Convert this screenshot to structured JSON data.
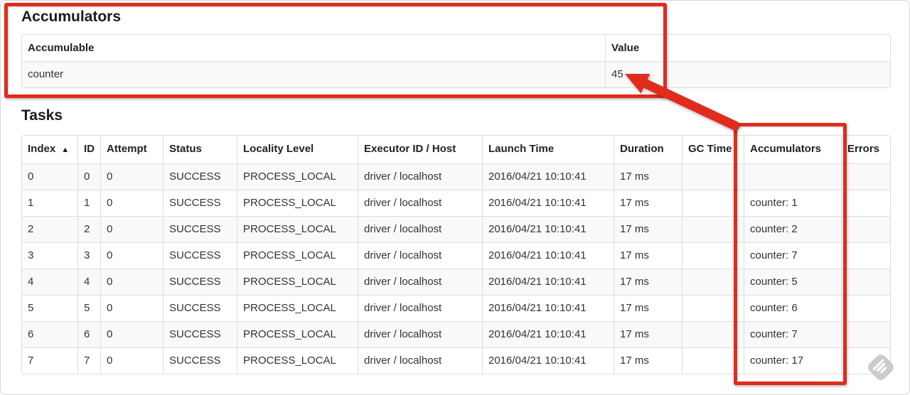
{
  "accumulators_section": {
    "title": "Accumulators",
    "columns": [
      "Accumulable",
      "Value"
    ],
    "rows": [
      {
        "accumulable": "counter",
        "value": "45"
      }
    ]
  },
  "tasks_section": {
    "title": "Tasks",
    "columns": [
      "Index",
      "ID",
      "Attempt",
      "Status",
      "Locality Level",
      "Executor ID / Host",
      "Launch Time",
      "Duration",
      "GC Time",
      "Accumulators",
      "Errors"
    ],
    "sorted_column": "Index",
    "rows": [
      {
        "index": "0",
        "id": "0",
        "attempt": "0",
        "status": "SUCCESS",
        "locality": "PROCESS_LOCAL",
        "executor": "driver / localhost",
        "launch": "2016/04/21 10:10:41",
        "duration": "17 ms",
        "gc": "",
        "accumulators": "",
        "errors": ""
      },
      {
        "index": "1",
        "id": "1",
        "attempt": "0",
        "status": "SUCCESS",
        "locality": "PROCESS_LOCAL",
        "executor": "driver / localhost",
        "launch": "2016/04/21 10:10:41",
        "duration": "17 ms",
        "gc": "",
        "accumulators": "counter: 1",
        "errors": ""
      },
      {
        "index": "2",
        "id": "2",
        "attempt": "0",
        "status": "SUCCESS",
        "locality": "PROCESS_LOCAL",
        "executor": "driver / localhost",
        "launch": "2016/04/21 10:10:41",
        "duration": "17 ms",
        "gc": "",
        "accumulators": "counter: 2",
        "errors": ""
      },
      {
        "index": "3",
        "id": "3",
        "attempt": "0",
        "status": "SUCCESS",
        "locality": "PROCESS_LOCAL",
        "executor": "driver / localhost",
        "launch": "2016/04/21 10:10:41",
        "duration": "17 ms",
        "gc": "",
        "accumulators": "counter: 7",
        "errors": ""
      },
      {
        "index": "4",
        "id": "4",
        "attempt": "0",
        "status": "SUCCESS",
        "locality": "PROCESS_LOCAL",
        "executor": "driver / localhost",
        "launch": "2016/04/21 10:10:41",
        "duration": "17 ms",
        "gc": "",
        "accumulators": "counter: 5",
        "errors": ""
      },
      {
        "index": "5",
        "id": "5",
        "attempt": "0",
        "status": "SUCCESS",
        "locality": "PROCESS_LOCAL",
        "executor": "driver / localhost",
        "launch": "2016/04/21 10:10:41",
        "duration": "17 ms",
        "gc": "",
        "accumulators": "counter: 6",
        "errors": ""
      },
      {
        "index": "6",
        "id": "6",
        "attempt": "0",
        "status": "SUCCESS",
        "locality": "PROCESS_LOCAL",
        "executor": "driver / localhost",
        "launch": "2016/04/21 10:10:41",
        "duration": "17 ms",
        "gc": "",
        "accumulators": "counter: 7",
        "errors": ""
      },
      {
        "index": "7",
        "id": "7",
        "attempt": "0",
        "status": "SUCCESS",
        "locality": "PROCESS_LOCAL",
        "executor": "driver / localhost",
        "launch": "2016/04/21 10:10:41",
        "duration": "17 ms",
        "gc": "",
        "accumulators": "counter: 17",
        "errors": ""
      }
    ]
  },
  "icons": {
    "sort_ascending": "▲"
  },
  "colors": {
    "annotation_red": "#e02b1d",
    "table_border": "#dddddd",
    "striped_row": "#f9f9f9",
    "text": "#333333"
  }
}
